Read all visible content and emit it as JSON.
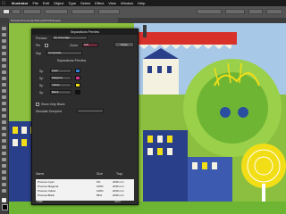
{
  "menubar": {
    "apple": "",
    "app": "Illustrator",
    "items": [
      "File",
      "Edit",
      "Object",
      "Type",
      "Select",
      "Effect",
      "View",
      "Window",
      "Help"
    ]
  },
  "document": {
    "tab": "Preview Proof.ai @ 66% (CMYK/Preview)"
  },
  "dialog": {
    "title": "Separations Preview",
    "preview_label": "Preview",
    "preview_value": "Ink Coverage",
    "pin_label": "Pin",
    "zoom_label": "Zoom",
    "zoom_value": "100",
    "close_label": "Close",
    "sep_label": "Sep",
    "sep_value": "Composite",
    "inks_header": "Separations Preview",
    "inks": [
      {
        "label": "Sp",
        "value": "Cyan",
        "color": "#2e7fd8"
      },
      {
        "label": "Sp",
        "value": "Magenta",
        "color": "#d7368f"
      },
      {
        "label": "Sp",
        "value": "Yellow",
        "color": "#f2de17"
      },
      {
        "label": "Sp",
        "value": "Black",
        "color": "#111111"
      }
    ],
    "show_only": "Show Only Black",
    "overprint_label": "Simulate Overprint",
    "list_headers": [
      "Name",
      "Size",
      "Trap"
    ],
    "list": [
      {
        "name": "Process Cyan",
        "pct": "0%",
        "dim": "2036 mm"
      },
      {
        "name": "Process Magenta",
        "pct": "100%",
        "dim": "2036 mm"
      },
      {
        "name": "Process Yellow",
        "pct": "100%",
        "dim": "2036 mm"
      },
      {
        "name": "Process Black",
        "pct": "85%",
        "dim": "2036 mm"
      }
    ],
    "footer_label": "Total",
    "footer_value": "96%"
  },
  "colors": {
    "canvas_green": "#8cbf3f",
    "sky_blue": "#a8c8e8",
    "dialog_bg": "#2d2d2d"
  }
}
